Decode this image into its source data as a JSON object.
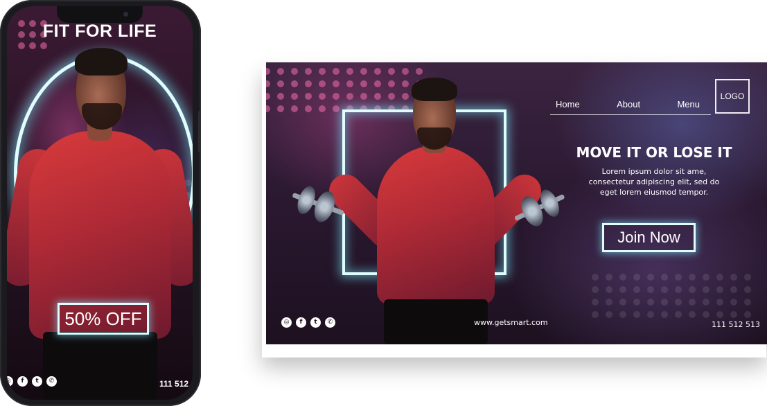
{
  "colors": {
    "neon": "#dffcff",
    "background_dark": "#2a1830",
    "shirt_red": "#c8343a",
    "dot_pink": "#f06eaa",
    "text": "#ffffff"
  },
  "phone": {
    "title": "FIT FOR LIFE",
    "offer": "50% OFF",
    "social_icons": [
      {
        "icon": "instagram-icon",
        "glyph": "◎"
      },
      {
        "icon": "facebook-icon",
        "glyph": "f"
      },
      {
        "icon": "twitter-icon",
        "glyph": "t"
      },
      {
        "icon": "whatsapp-icon",
        "glyph": "✆"
      }
    ],
    "phone_number": "111 512"
  },
  "banner": {
    "nav": [
      "Home",
      "About",
      "Menu"
    ],
    "logo": "LOGO",
    "headline": "MOVE IT OR LOSE IT",
    "body_lines": [
      "Lorem ipsum dolor sit ame,",
      "consectetur adipiscing elit, sed do",
      "eget lorem eiusmod tempor."
    ],
    "cta": "Join Now",
    "social_icons": [
      {
        "icon": "instagram-icon",
        "glyph": "◎"
      },
      {
        "icon": "facebook-icon",
        "glyph": "f"
      },
      {
        "icon": "twitter-icon",
        "glyph": "t"
      },
      {
        "icon": "whatsapp-icon",
        "glyph": "✆"
      }
    ],
    "website": "www.getsmart.com",
    "phone_number": "111 512 513"
  }
}
